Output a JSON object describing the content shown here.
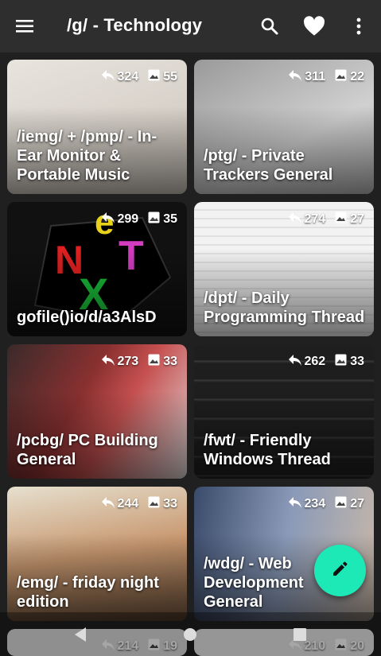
{
  "appbar": {
    "title": "/g/ - Technology",
    "menu_icon": "menu-icon",
    "search_icon": "search-icon",
    "favorite_icon": "heart-icon",
    "overflow_icon": "more-vert-icon"
  },
  "threads": [
    {
      "title": "/iemg/ + /pmp/ - In-Ear Monitor & Portable Music Player General",
      "replies": "324",
      "images": "55",
      "bg": "#d9d5d0"
    },
    {
      "title": "/ptg/ - Private Trackers General",
      "replies": "311",
      "images": "22",
      "bg": "#bdbdbd"
    },
    {
      "title": "gofile()io/d/a3AlsD",
      "replies": "299",
      "images": "35",
      "bg": "#1a1a1a"
    },
    {
      "title": "/dpt/ - Daily Programming Thread",
      "replies": "274",
      "images": "27",
      "bg": "#efefef"
    },
    {
      "title": "/pcbg/ PC Building General",
      "replies": "273",
      "images": "33",
      "bg": "#9a5050"
    },
    {
      "title": "/fwt/ - Friendly Windows Thread",
      "replies": "262",
      "images": "33",
      "bg": "#2a2a2a"
    },
    {
      "title": "/emg/ - friday night edition",
      "replies": "244",
      "images": "33",
      "bg": "#d8c7a0"
    },
    {
      "title": "/wdg/ - Web Development General",
      "replies": "234",
      "images": "27",
      "bg": "#6a7890"
    },
    {
      "title": "",
      "replies": "214",
      "images": "19",
      "bg": "#e0e0e0"
    },
    {
      "title": "",
      "replies": "210",
      "images": "20",
      "bg": "#e8e8e8"
    }
  ],
  "fab": {
    "icon": "edit-icon"
  },
  "colors": {
    "accent": "#1de9b6",
    "appbar": "#2e2e2e",
    "background": "#202020"
  }
}
